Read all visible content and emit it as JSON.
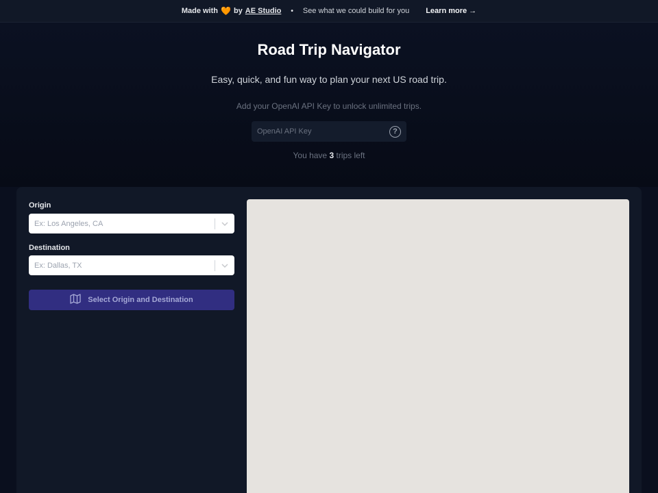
{
  "banner": {
    "made_with": "Made with",
    "heart": "🧡",
    "by": "by",
    "studio": "AE Studio",
    "dot": "•",
    "pitch": "See what we could build for you",
    "learn_more": "Learn more →"
  },
  "header": {
    "title": "Road Trip Navigator",
    "subtitle": "Easy, quick, and fun way to plan your next US road trip."
  },
  "api": {
    "note": "Add your OpenAI API Key to unlock unlimited trips.",
    "placeholder": "OpenAI API Key",
    "help": "?"
  },
  "trips": {
    "prefix": "You have",
    "count": "3",
    "suffix": "trips left"
  },
  "form": {
    "origin_label": "Origin",
    "origin_placeholder": "Ex: Los Angeles, CA",
    "destination_label": "Destination",
    "destination_placeholder": "Ex: Dallas, TX",
    "route_button": "Select Origin and Destination"
  },
  "icons": {
    "heart": "heart-icon",
    "help": "question-circle-icon",
    "chevron": "chevron-down-icon",
    "map": "map-icon"
  },
  "colors": {
    "background": "#0a0f1e",
    "panel": "#111827",
    "button": "#312e81",
    "map": "#e6e3df",
    "heart": "#f59e0b"
  }
}
